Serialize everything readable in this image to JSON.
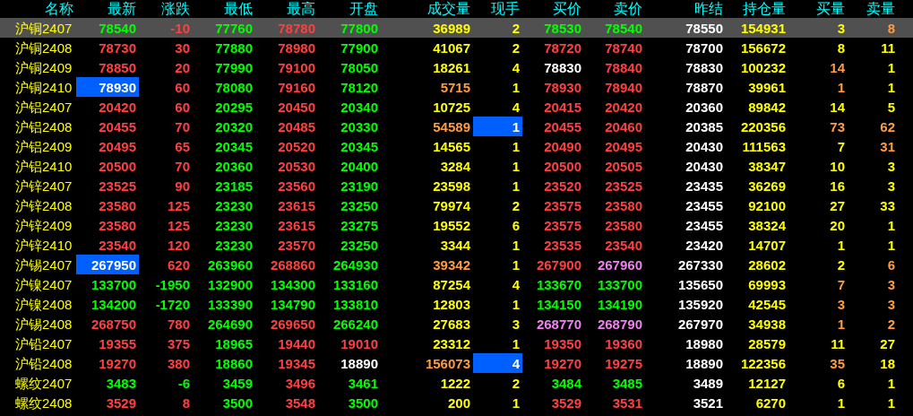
{
  "columns": [
    "名称",
    "最新",
    "涨跌",
    "最低",
    "最高",
    "开盘",
    "成交量",
    "现手",
    "买价",
    "卖价",
    "昨结",
    "持仓量",
    "买量",
    "卖量"
  ],
  "rows": [
    {
      "name": "沪铜2407",
      "selected": true,
      "cells": [
        {
          "text": "78540",
          "color": "#00ff00",
          "highlighted": false
        },
        {
          "text": "-10",
          "color": "#ff4040",
          "highlighted": false
        },
        {
          "text": "77760",
          "color": "#00ff00",
          "highlighted": false
        },
        {
          "text": "78780",
          "color": "#ff4040",
          "highlighted": false
        },
        {
          "text": "77800",
          "color": "#00ff00",
          "highlighted": false
        },
        {
          "text": "36989",
          "color": "#ffff00",
          "highlighted": false
        },
        {
          "text": "2",
          "color": "#ffff00",
          "highlighted": false
        },
        {
          "text": "78530",
          "color": "#00ff00",
          "highlighted": false
        },
        {
          "text": "78540",
          "color": "#00ff00",
          "highlighted": false
        },
        {
          "text": "78550",
          "color": "#ffffff",
          "highlighted": false
        },
        {
          "text": "154931",
          "color": "#ffff00",
          "highlighted": false
        },
        {
          "text": "3",
          "color": "#ffff00",
          "highlighted": false
        },
        {
          "text": "8",
          "color": "#ff9c40",
          "highlighted": false
        }
      ]
    },
    {
      "name": "沪铜2408",
      "selected": false,
      "cells": [
        {
          "text": "78730",
          "color": "#ff4040",
          "highlighted": false
        },
        {
          "text": "30",
          "color": "#ff4040",
          "highlighted": false
        },
        {
          "text": "77880",
          "color": "#00ff00",
          "highlighted": false
        },
        {
          "text": "78980",
          "color": "#ff4040",
          "highlighted": false
        },
        {
          "text": "77900",
          "color": "#00ff00",
          "highlighted": false
        },
        {
          "text": "41067",
          "color": "#ffff00",
          "highlighted": false
        },
        {
          "text": "2",
          "color": "#ffff00",
          "highlighted": false
        },
        {
          "text": "78720",
          "color": "#ff4040",
          "highlighted": false
        },
        {
          "text": "78740",
          "color": "#ff4040",
          "highlighted": false
        },
        {
          "text": "78700",
          "color": "#ffffff",
          "highlighted": false
        },
        {
          "text": "156672",
          "color": "#ffff00",
          "highlighted": false
        },
        {
          "text": "8",
          "color": "#ffff00",
          "highlighted": false
        },
        {
          "text": "11",
          "color": "#ffff00",
          "highlighted": false
        }
      ]
    },
    {
      "name": "沪铜2409",
      "selected": false,
      "cells": [
        {
          "text": "78850",
          "color": "#ff4040",
          "highlighted": false
        },
        {
          "text": "20",
          "color": "#ff4040",
          "highlighted": false
        },
        {
          "text": "77990",
          "color": "#00ff00",
          "highlighted": false
        },
        {
          "text": "79100",
          "color": "#ff4040",
          "highlighted": false
        },
        {
          "text": "78050",
          "color": "#00ff00",
          "highlighted": false
        },
        {
          "text": "18261",
          "color": "#ffff00",
          "highlighted": false
        },
        {
          "text": "4",
          "color": "#ffff00",
          "highlighted": false
        },
        {
          "text": "78830",
          "color": "#ffffff",
          "highlighted": false
        },
        {
          "text": "78840",
          "color": "#ff4040",
          "highlighted": false
        },
        {
          "text": "78830",
          "color": "#ffffff",
          "highlighted": false
        },
        {
          "text": "100232",
          "color": "#ffff00",
          "highlighted": false
        },
        {
          "text": "14",
          "color": "#ff9c40",
          "highlighted": false
        },
        {
          "text": "1",
          "color": "#ffff00",
          "highlighted": false
        }
      ]
    },
    {
      "name": "沪铜2410",
      "selected": false,
      "cells": [
        {
          "text": "78930",
          "color": "#ffffff",
          "highlighted": true
        },
        {
          "text": "60",
          "color": "#ff4040",
          "highlighted": false
        },
        {
          "text": "78080",
          "color": "#00ff00",
          "highlighted": false
        },
        {
          "text": "79160",
          "color": "#ff4040",
          "highlighted": false
        },
        {
          "text": "78120",
          "color": "#00ff00",
          "highlighted": false
        },
        {
          "text": "5715",
          "color": "#ff9c40",
          "highlighted": false
        },
        {
          "text": "1",
          "color": "#ffff00",
          "highlighted": false
        },
        {
          "text": "78930",
          "color": "#ff4040",
          "highlighted": false
        },
        {
          "text": "78940",
          "color": "#ff4040",
          "highlighted": false
        },
        {
          "text": "78870",
          "color": "#ffffff",
          "highlighted": false
        },
        {
          "text": "39961",
          "color": "#ffff00",
          "highlighted": false
        },
        {
          "text": "1",
          "color": "#ff9c40",
          "highlighted": false
        },
        {
          "text": "1",
          "color": "#ffff00",
          "highlighted": false
        }
      ]
    },
    {
      "name": "沪铝2407",
      "selected": false,
      "cells": [
        {
          "text": "20420",
          "color": "#ff4040",
          "highlighted": false
        },
        {
          "text": "60",
          "color": "#ff4040",
          "highlighted": false
        },
        {
          "text": "20295",
          "color": "#00ff00",
          "highlighted": false
        },
        {
          "text": "20450",
          "color": "#ff4040",
          "highlighted": false
        },
        {
          "text": "20340",
          "color": "#00ff00",
          "highlighted": false
        },
        {
          "text": "10725",
          "color": "#ffff00",
          "highlighted": false
        },
        {
          "text": "4",
          "color": "#ffff00",
          "highlighted": false
        },
        {
          "text": "20415",
          "color": "#ff4040",
          "highlighted": false
        },
        {
          "text": "20420",
          "color": "#ff4040",
          "highlighted": false
        },
        {
          "text": "20360",
          "color": "#ffffff",
          "highlighted": false
        },
        {
          "text": "89842",
          "color": "#ffff00",
          "highlighted": false
        },
        {
          "text": "14",
          "color": "#ffff00",
          "highlighted": false
        },
        {
          "text": "5",
          "color": "#ffff00",
          "highlighted": false
        }
      ]
    },
    {
      "name": "沪铝2408",
      "selected": false,
      "cells": [
        {
          "text": "20455",
          "color": "#ff4040",
          "highlighted": false
        },
        {
          "text": "70",
          "color": "#ff4040",
          "highlighted": false
        },
        {
          "text": "20320",
          "color": "#00ff00",
          "highlighted": false
        },
        {
          "text": "20485",
          "color": "#ff4040",
          "highlighted": false
        },
        {
          "text": "20330",
          "color": "#00ff00",
          "highlighted": false
        },
        {
          "text": "54589",
          "color": "#ff9c40",
          "highlighted": false
        },
        {
          "text": "1",
          "color": "#ffffff",
          "highlighted": true
        },
        {
          "text": "20455",
          "color": "#ff4040",
          "highlighted": false
        },
        {
          "text": "20460",
          "color": "#ff4040",
          "highlighted": false
        },
        {
          "text": "20385",
          "color": "#ffffff",
          "highlighted": false
        },
        {
          "text": "220356",
          "color": "#ffff00",
          "highlighted": false
        },
        {
          "text": "73",
          "color": "#ff9c40",
          "highlighted": false
        },
        {
          "text": "62",
          "color": "#ff9c40",
          "highlighted": false
        }
      ]
    },
    {
      "name": "沪铝2409",
      "selected": false,
      "cells": [
        {
          "text": "20495",
          "color": "#ff4040",
          "highlighted": false
        },
        {
          "text": "65",
          "color": "#ff4040",
          "highlighted": false
        },
        {
          "text": "20345",
          "color": "#00ff00",
          "highlighted": false
        },
        {
          "text": "20520",
          "color": "#ff4040",
          "highlighted": false
        },
        {
          "text": "20345",
          "color": "#00ff00",
          "highlighted": false
        },
        {
          "text": "14565",
          "color": "#ffff00",
          "highlighted": false
        },
        {
          "text": "1",
          "color": "#ffff00",
          "highlighted": false
        },
        {
          "text": "20490",
          "color": "#ff4040",
          "highlighted": false
        },
        {
          "text": "20495",
          "color": "#ff4040",
          "highlighted": false
        },
        {
          "text": "20430",
          "color": "#ffffff",
          "highlighted": false
        },
        {
          "text": "111563",
          "color": "#ffff00",
          "highlighted": false
        },
        {
          "text": "7",
          "color": "#ffff00",
          "highlighted": false
        },
        {
          "text": "31",
          "color": "#ff9c40",
          "highlighted": false
        }
      ]
    },
    {
      "name": "沪铝2410",
      "selected": false,
      "cells": [
        {
          "text": "20500",
          "color": "#ff4040",
          "highlighted": false
        },
        {
          "text": "70",
          "color": "#ff4040",
          "highlighted": false
        },
        {
          "text": "20360",
          "color": "#00ff00",
          "highlighted": false
        },
        {
          "text": "20530",
          "color": "#ff4040",
          "highlighted": false
        },
        {
          "text": "20400",
          "color": "#00ff00",
          "highlighted": false
        },
        {
          "text": "3284",
          "color": "#ffff00",
          "highlighted": false
        },
        {
          "text": "1",
          "color": "#ffff00",
          "highlighted": false
        },
        {
          "text": "20500",
          "color": "#ff4040",
          "highlighted": false
        },
        {
          "text": "20505",
          "color": "#ff4040",
          "highlighted": false
        },
        {
          "text": "20430",
          "color": "#ffffff",
          "highlighted": false
        },
        {
          "text": "38347",
          "color": "#ffff00",
          "highlighted": false
        },
        {
          "text": "10",
          "color": "#ffff00",
          "highlighted": false
        },
        {
          "text": "3",
          "color": "#ffff00",
          "highlighted": false
        }
      ]
    },
    {
      "name": "沪锌2407",
      "selected": false,
      "cells": [
        {
          "text": "23525",
          "color": "#ff4040",
          "highlighted": false
        },
        {
          "text": "90",
          "color": "#ff4040",
          "highlighted": false
        },
        {
          "text": "23185",
          "color": "#00ff00",
          "highlighted": false
        },
        {
          "text": "23560",
          "color": "#ff4040",
          "highlighted": false
        },
        {
          "text": "23190",
          "color": "#00ff00",
          "highlighted": false
        },
        {
          "text": "23598",
          "color": "#ffff00",
          "highlighted": false
        },
        {
          "text": "1",
          "color": "#ffff00",
          "highlighted": false
        },
        {
          "text": "23520",
          "color": "#ff4040",
          "highlighted": false
        },
        {
          "text": "23525",
          "color": "#ff4040",
          "highlighted": false
        },
        {
          "text": "23435",
          "color": "#ffffff",
          "highlighted": false
        },
        {
          "text": "36269",
          "color": "#ffff00",
          "highlighted": false
        },
        {
          "text": "16",
          "color": "#ffff00",
          "highlighted": false
        },
        {
          "text": "3",
          "color": "#ffff00",
          "highlighted": false
        }
      ]
    },
    {
      "name": "沪锌2408",
      "selected": false,
      "cells": [
        {
          "text": "23580",
          "color": "#ff4040",
          "highlighted": false
        },
        {
          "text": "125",
          "color": "#ff4040",
          "highlighted": false
        },
        {
          "text": "23230",
          "color": "#00ff00",
          "highlighted": false
        },
        {
          "text": "23615",
          "color": "#ff4040",
          "highlighted": false
        },
        {
          "text": "23250",
          "color": "#00ff00",
          "highlighted": false
        },
        {
          "text": "79974",
          "color": "#ffff00",
          "highlighted": false
        },
        {
          "text": "2",
          "color": "#ffff00",
          "highlighted": false
        },
        {
          "text": "23575",
          "color": "#ff4040",
          "highlighted": false
        },
        {
          "text": "23580",
          "color": "#ff4040",
          "highlighted": false
        },
        {
          "text": "23455",
          "color": "#ffffff",
          "highlighted": false
        },
        {
          "text": "92100",
          "color": "#ffff00",
          "highlighted": false
        },
        {
          "text": "27",
          "color": "#ffff00",
          "highlighted": false
        },
        {
          "text": "33",
          "color": "#ffff00",
          "highlighted": false
        }
      ]
    },
    {
      "name": "沪锌2409",
      "selected": false,
      "cells": [
        {
          "text": "23580",
          "color": "#ff4040",
          "highlighted": false
        },
        {
          "text": "125",
          "color": "#ff4040",
          "highlighted": false
        },
        {
          "text": "23230",
          "color": "#00ff00",
          "highlighted": false
        },
        {
          "text": "23615",
          "color": "#ff4040",
          "highlighted": false
        },
        {
          "text": "23275",
          "color": "#00ff00",
          "highlighted": false
        },
        {
          "text": "19552",
          "color": "#ffff00",
          "highlighted": false
        },
        {
          "text": "6",
          "color": "#ffff00",
          "highlighted": false
        },
        {
          "text": "23575",
          "color": "#ff4040",
          "highlighted": false
        },
        {
          "text": "23580",
          "color": "#ff4040",
          "highlighted": false
        },
        {
          "text": "23455",
          "color": "#ffffff",
          "highlighted": false
        },
        {
          "text": "38324",
          "color": "#ffff00",
          "highlighted": false
        },
        {
          "text": "20",
          "color": "#ffff00",
          "highlighted": false
        },
        {
          "text": "1",
          "color": "#ffff00",
          "highlighted": false
        }
      ]
    },
    {
      "name": "沪锌2410",
      "selected": false,
      "cells": [
        {
          "text": "23540",
          "color": "#ff4040",
          "highlighted": false
        },
        {
          "text": "120",
          "color": "#ff4040",
          "highlighted": false
        },
        {
          "text": "23230",
          "color": "#00ff00",
          "highlighted": false
        },
        {
          "text": "23570",
          "color": "#ff4040",
          "highlighted": false
        },
        {
          "text": "23250",
          "color": "#00ff00",
          "highlighted": false
        },
        {
          "text": "3344",
          "color": "#ffff00",
          "highlighted": false
        },
        {
          "text": "1",
          "color": "#ffff00",
          "highlighted": false
        },
        {
          "text": "23535",
          "color": "#ff4040",
          "highlighted": false
        },
        {
          "text": "23540",
          "color": "#ff4040",
          "highlighted": false
        },
        {
          "text": "23420",
          "color": "#ffffff",
          "highlighted": false
        },
        {
          "text": "14707",
          "color": "#ffff00",
          "highlighted": false
        },
        {
          "text": "1",
          "color": "#ffff00",
          "highlighted": false
        },
        {
          "text": "1",
          "color": "#ffff00",
          "highlighted": false
        }
      ]
    },
    {
      "name": "沪锡2407",
      "selected": false,
      "cells": [
        {
          "text": "267950",
          "color": "#ffffff",
          "highlighted": true
        },
        {
          "text": "620",
          "color": "#ff4040",
          "highlighted": false
        },
        {
          "text": "263960",
          "color": "#00ff00",
          "highlighted": false
        },
        {
          "text": "268860",
          "color": "#ff4040",
          "highlighted": false
        },
        {
          "text": "264930",
          "color": "#00ff00",
          "highlighted": false
        },
        {
          "text": "39342",
          "color": "#ff9c40",
          "highlighted": false
        },
        {
          "text": "1",
          "color": "#ffff00",
          "highlighted": false
        },
        {
          "text": "267900",
          "color": "#ff4040",
          "highlighted": false
        },
        {
          "text": "267960",
          "color": "#ee82ee",
          "highlighted": false
        },
        {
          "text": "267330",
          "color": "#ffffff",
          "highlighted": false
        },
        {
          "text": "28602",
          "color": "#ffff00",
          "highlighted": false
        },
        {
          "text": "2",
          "color": "#ffff00",
          "highlighted": false
        },
        {
          "text": "6",
          "color": "#ff9c40",
          "highlighted": false
        }
      ]
    },
    {
      "name": "沪镍2407",
      "selected": false,
      "cells": [
        {
          "text": "133700",
          "color": "#00ff00",
          "highlighted": false
        },
        {
          "text": "-1950",
          "color": "#00ff00",
          "highlighted": false
        },
        {
          "text": "132900",
          "color": "#00ff00",
          "highlighted": false
        },
        {
          "text": "134300",
          "color": "#00ff00",
          "highlighted": false
        },
        {
          "text": "133160",
          "color": "#00ff00",
          "highlighted": false
        },
        {
          "text": "87254",
          "color": "#ffff00",
          "highlighted": false
        },
        {
          "text": "4",
          "color": "#ffff00",
          "highlighted": false
        },
        {
          "text": "133670",
          "color": "#00ff00",
          "highlighted": false
        },
        {
          "text": "133700",
          "color": "#00ff00",
          "highlighted": false
        },
        {
          "text": "135650",
          "color": "#ffffff",
          "highlighted": false
        },
        {
          "text": "69993",
          "color": "#ffff00",
          "highlighted": false
        },
        {
          "text": "7",
          "color": "#ff9c40",
          "highlighted": false
        },
        {
          "text": "3",
          "color": "#ff9c40",
          "highlighted": false
        }
      ]
    },
    {
      "name": "沪镍2408",
      "selected": false,
      "cells": [
        {
          "text": "134200",
          "color": "#00ff00",
          "highlighted": false
        },
        {
          "text": "-1720",
          "color": "#00ff00",
          "highlighted": false
        },
        {
          "text": "133390",
          "color": "#00ff00",
          "highlighted": false
        },
        {
          "text": "134790",
          "color": "#00ff00",
          "highlighted": false
        },
        {
          "text": "133810",
          "color": "#00ff00",
          "highlighted": false
        },
        {
          "text": "12803",
          "color": "#ffff00",
          "highlighted": false
        },
        {
          "text": "1",
          "color": "#ffff00",
          "highlighted": false
        },
        {
          "text": "134150",
          "color": "#00ff00",
          "highlighted": false
        },
        {
          "text": "134190",
          "color": "#00ff00",
          "highlighted": false
        },
        {
          "text": "135920",
          "color": "#ffffff",
          "highlighted": false
        },
        {
          "text": "42545",
          "color": "#ffff00",
          "highlighted": false
        },
        {
          "text": "3",
          "color": "#ff9c40",
          "highlighted": false
        },
        {
          "text": "3",
          "color": "#ff9c40",
          "highlighted": false
        }
      ]
    },
    {
      "name": "沪锡2408",
      "selected": false,
      "cells": [
        {
          "text": "268750",
          "color": "#ff4040",
          "highlighted": false
        },
        {
          "text": "780",
          "color": "#ff4040",
          "highlighted": false
        },
        {
          "text": "264690",
          "color": "#00ff00",
          "highlighted": false
        },
        {
          "text": "269650",
          "color": "#ff4040",
          "highlighted": false
        },
        {
          "text": "266240",
          "color": "#00ff00",
          "highlighted": false
        },
        {
          "text": "27683",
          "color": "#ffff00",
          "highlighted": false
        },
        {
          "text": "3",
          "color": "#ffff00",
          "highlighted": false
        },
        {
          "text": "268770",
          "color": "#ee82ee",
          "highlighted": false
        },
        {
          "text": "268790",
          "color": "#ee82ee",
          "highlighted": false
        },
        {
          "text": "267970",
          "color": "#ffffff",
          "highlighted": false
        },
        {
          "text": "34938",
          "color": "#ffff00",
          "highlighted": false
        },
        {
          "text": "1",
          "color": "#ff9c40",
          "highlighted": false
        },
        {
          "text": "2",
          "color": "#ff9c40",
          "highlighted": false
        }
      ]
    },
    {
      "name": "沪铅2407",
      "selected": false,
      "cells": [
        {
          "text": "19355",
          "color": "#ff4040",
          "highlighted": false
        },
        {
          "text": "375",
          "color": "#ff4040",
          "highlighted": false
        },
        {
          "text": "18965",
          "color": "#00ff00",
          "highlighted": false
        },
        {
          "text": "19440",
          "color": "#ff4040",
          "highlighted": false
        },
        {
          "text": "19010",
          "color": "#ff4040",
          "highlighted": false
        },
        {
          "text": "23312",
          "color": "#ffff00",
          "highlighted": false
        },
        {
          "text": "1",
          "color": "#ffff00",
          "highlighted": false
        },
        {
          "text": "19350",
          "color": "#ff4040",
          "highlighted": false
        },
        {
          "text": "19360",
          "color": "#ff4040",
          "highlighted": false
        },
        {
          "text": "18980",
          "color": "#ffffff",
          "highlighted": false
        },
        {
          "text": "28579",
          "color": "#ffff00",
          "highlighted": false
        },
        {
          "text": "11",
          "color": "#ffff00",
          "highlighted": false
        },
        {
          "text": "27",
          "color": "#ffff00",
          "highlighted": false
        }
      ]
    },
    {
      "name": "沪铅2408",
      "selected": false,
      "cells": [
        {
          "text": "19270",
          "color": "#ff4040",
          "highlighted": false
        },
        {
          "text": "380",
          "color": "#ff4040",
          "highlighted": false
        },
        {
          "text": "18860",
          "color": "#00ff00",
          "highlighted": false
        },
        {
          "text": "19345",
          "color": "#ff4040",
          "highlighted": false
        },
        {
          "text": "18890",
          "color": "#ffffff",
          "highlighted": false
        },
        {
          "text": "156073",
          "color": "#ff9c40",
          "highlighted": false
        },
        {
          "text": "4",
          "color": "#ffffff",
          "highlighted": true
        },
        {
          "text": "19270",
          "color": "#ff4040",
          "highlighted": false
        },
        {
          "text": "19275",
          "color": "#ff4040",
          "highlighted": false
        },
        {
          "text": "18890",
          "color": "#ffffff",
          "highlighted": false
        },
        {
          "text": "122356",
          "color": "#ffff00",
          "highlighted": false
        },
        {
          "text": "35",
          "color": "#ff9c40",
          "highlighted": false
        },
        {
          "text": "18",
          "color": "#ffff00",
          "highlighted": false
        }
      ]
    },
    {
      "name": "螺纹2407",
      "selected": false,
      "cells": [
        {
          "text": "3483",
          "color": "#00ff00",
          "highlighted": false
        },
        {
          "text": "-6",
          "color": "#00ff00",
          "highlighted": false
        },
        {
          "text": "3459",
          "color": "#00ff00",
          "highlighted": false
        },
        {
          "text": "3496",
          "color": "#ff4040",
          "highlighted": false
        },
        {
          "text": "3461",
          "color": "#00ff00",
          "highlighted": false
        },
        {
          "text": "1222",
          "color": "#ffff00",
          "highlighted": false
        },
        {
          "text": "2",
          "color": "#ffff00",
          "highlighted": false
        },
        {
          "text": "3484",
          "color": "#00ff00",
          "highlighted": false
        },
        {
          "text": "3485",
          "color": "#00ff00",
          "highlighted": false
        },
        {
          "text": "3489",
          "color": "#ffffff",
          "highlighted": false
        },
        {
          "text": "12127",
          "color": "#ffff00",
          "highlighted": false
        },
        {
          "text": "6",
          "color": "#ffff00",
          "highlighted": false
        },
        {
          "text": "1",
          "color": "#ffff00",
          "highlighted": false
        }
      ]
    },
    {
      "name": "螺纹2408",
      "selected": false,
      "cells": [
        {
          "text": "3529",
          "color": "#ff4040",
          "highlighted": false
        },
        {
          "text": "8",
          "color": "#ff4040",
          "highlighted": false
        },
        {
          "text": "3500",
          "color": "#00ff00",
          "highlighted": false
        },
        {
          "text": "3548",
          "color": "#ff4040",
          "highlighted": false
        },
        {
          "text": "3500",
          "color": "#00ff00",
          "highlighted": false
        },
        {
          "text": "200",
          "color": "#ffff00",
          "highlighted": false
        },
        {
          "text": "1",
          "color": "#ffff00",
          "highlighted": false
        },
        {
          "text": "3529",
          "color": "#ff4040",
          "highlighted": false
        },
        {
          "text": "3531",
          "color": "#ff4040",
          "highlighted": false
        },
        {
          "text": "3521",
          "color": "#ffffff",
          "highlighted": false
        },
        {
          "text": "6270",
          "color": "#ffff00",
          "highlighted": false
        },
        {
          "text": "1",
          "color": "#ffff00",
          "highlighted": false
        },
        {
          "text": "1",
          "color": "#ffff00",
          "highlighted": false
        }
      ]
    }
  ]
}
